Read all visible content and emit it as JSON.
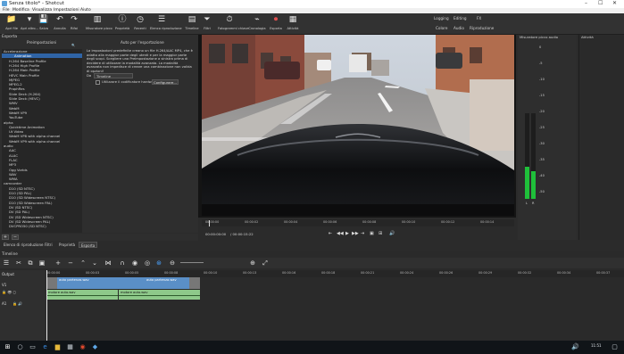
{
  "window": {
    "title": "Senza titolo* - Shotcut",
    "controls": [
      "–",
      "☐",
      "✕"
    ]
  },
  "menu": [
    "File",
    "Modifica",
    "Visualizza",
    "Impostazioni",
    "Aiuto"
  ],
  "toolbar": {
    "buttons": [
      {
        "label": "Apri file",
        "icon": "📁"
      },
      {
        "label": "Apri altro...",
        "icon": "▾"
      },
      {
        "label": "Salva",
        "icon": "💾"
      },
      {
        "label": "Annulla",
        "icon": "↶"
      },
      {
        "label": "Rifai",
        "icon": "↷"
      },
      {
        "label": "Misuratore picco",
        "icon": "▥"
      },
      {
        "label": "Proprietà",
        "icon": "ⓘ"
      },
      {
        "label": "Recenti",
        "icon": "◷"
      },
      {
        "label": "Elenco riproduzione",
        "icon": "☰"
      },
      {
        "label": "Timeline",
        "icon": "▤"
      },
      {
        "label": "Filtri",
        "icon": "⏷"
      },
      {
        "label": "Fotogrammi chiave",
        "icon": "⏱"
      },
      {
        "label": "Cronologia",
        "icon": "⌁"
      },
      {
        "label": "Esporta",
        "icon": "⏺"
      },
      {
        "label": "Attività",
        "icon": "▦"
      }
    ],
    "layouts": [
      "Logging",
      "Editing",
      "FX",
      "Colore",
      "Audio",
      "Riproduzione"
    ]
  },
  "export": {
    "panel_title": "Esporta",
    "presets_title": "Preimpostazioni",
    "content_title": "Auto per l'esportazione",
    "description": "La impostazioni predefinite creano un file H.264/AAC MP4, che è adatto alla maggior parte degli utenti e per la maggior parte degli scopi. Scegliere una Preimpostazione a sinistra prima di decidere di utilizzare la modalità avanzata. La modalità avanzata non impedisce di creare una combinazione non valida di opzioni!",
    "from_label": "Da",
    "from_value": "Timeline",
    "hw_encoder_label": "Utilizzare il codificatore hardware",
    "configure_label": "Configurare...",
    "buttons": [
      "Esporta file",
      "Ripristina",
      "Avanzato"
    ],
    "presets": [
      {
        "label": "Accelerazione",
        "level": 0
      },
      {
        "label": "Animation",
        "level": 2,
        "selected": true
      },
      {
        "label": "H.264 Baseline Profile",
        "level": 1
      },
      {
        "label": "H.264 High Profile",
        "level": 1
      },
      {
        "label": "H.264 Main Profile",
        "level": 1
      },
      {
        "label": "HEVC Main Profile",
        "level": 1
      },
      {
        "label": "MJPEG",
        "level": 1
      },
      {
        "label": "MPEG-2",
        "level": 1
      },
      {
        "label": "ProphRes",
        "level": 1
      },
      {
        "label": "Slide Deck (H.264)",
        "level": 1
      },
      {
        "label": "Slide Deck (HEVC)",
        "level": 1
      },
      {
        "label": "WMV",
        "level": 1
      },
      {
        "label": "WebM",
        "level": 1
      },
      {
        "label": "WebM VP9",
        "level": 1
      },
      {
        "label": "YouTube",
        "level": 1
      },
      {
        "label": "alpha",
        "level": 0
      },
      {
        "label": "Quicktime Animation",
        "level": 1
      },
      {
        "label": "Ut Video",
        "level": 1
      },
      {
        "label": "WebM VP8 with alpha channel",
        "level": 1
      },
      {
        "label": "WebM VP9 with alpha channel",
        "level": 1
      },
      {
        "label": "audio",
        "level": 0
      },
      {
        "label": "AAC",
        "level": 1
      },
      {
        "label": "ALAC",
        "level": 1
      },
      {
        "label": "FLAC",
        "level": 1
      },
      {
        "label": "MP3",
        "level": 1
      },
      {
        "label": "Ogg Vorbis",
        "level": 1
      },
      {
        "label": "WAV",
        "level": 1
      },
      {
        "label": "WMA",
        "level": 1
      },
      {
        "label": "camcorder",
        "level": 0
      },
      {
        "label": "D10 (SD NTSC)",
        "level": 1
      },
      {
        "label": "D10 (SD PAL)",
        "level": 1
      },
      {
        "label": "D10 (SD Widescreen NTSC)",
        "level": 1
      },
      {
        "label": "D10 (SD Widescreen PAL)",
        "level": 1
      },
      {
        "label": "DV (SD NTSC)",
        "level": 1
      },
      {
        "label": "DV (SD PAL)",
        "level": 1
      },
      {
        "label": "DV (SD Widescreen NTSC)",
        "level": 1
      },
      {
        "label": "DV (SD Widescreen PAL)",
        "level": 1
      },
      {
        "label": "DVCPRO50 (SD NTSC)",
        "level": 1
      }
    ],
    "add_icon": "+",
    "remove_icon": "−"
  },
  "player": {
    "ruler": [
      "00:00:00",
      "00:00:02",
      "00:00:04",
      "00:00:06",
      "00:00:08",
      "00:00:10",
      "00:00:12",
      "00:00:14"
    ],
    "position": "00:00:00:00",
    "duration": "/ 00:00:15:22",
    "tabs": [
      "Sorgente",
      "Progetto"
    ],
    "controls": [
      "⇤",
      "◀◀",
      "▶",
      "▶▶",
      "⇥",
      "▣",
      "⊞",
      "🔊"
    ]
  },
  "audio_meter": {
    "title": "Misuratore picco audio",
    "scale": [
      "0",
      "-5",
      "-10",
      "-15",
      "-20",
      "-25",
      "-30",
      "-35",
      "-40",
      "-50"
    ],
    "left_level": 0.38,
    "right_level": 0.32,
    "channels": [
      "L",
      "R"
    ]
  },
  "activity": {
    "title": "Attività",
    "pause_label": "Pausa"
  },
  "panel_tabs": [
    "Elenco di riproduzione",
    "Filtri",
    "Proprietà",
    "Esporta"
  ],
  "timeline": {
    "title": "Timeline",
    "ruler": [
      "00:00:00",
      "00:00:03",
      "00:00:05",
      "00:00:08",
      "00:00:10",
      "00:00:13",
      "00:00:16",
      "00:00:18",
      "00:00:21",
      "00:00:24",
      "00:00:26",
      "00:00:29",
      "00:00:32",
      "00:00:34",
      "00:00:37"
    ],
    "tracks": [
      {
        "name": "Output"
      },
      {
        "name": "V1"
      },
      {
        "name": "A1"
      }
    ],
    "clips": {
      "v1a": "auto partenza.wav",
      "v1b": "auto partenza.wav",
      "a1a": "motore auto.wav",
      "a1b": "motore auto.wav"
    }
  },
  "taskbar": {
    "time": "11:51",
    "date": ""
  }
}
